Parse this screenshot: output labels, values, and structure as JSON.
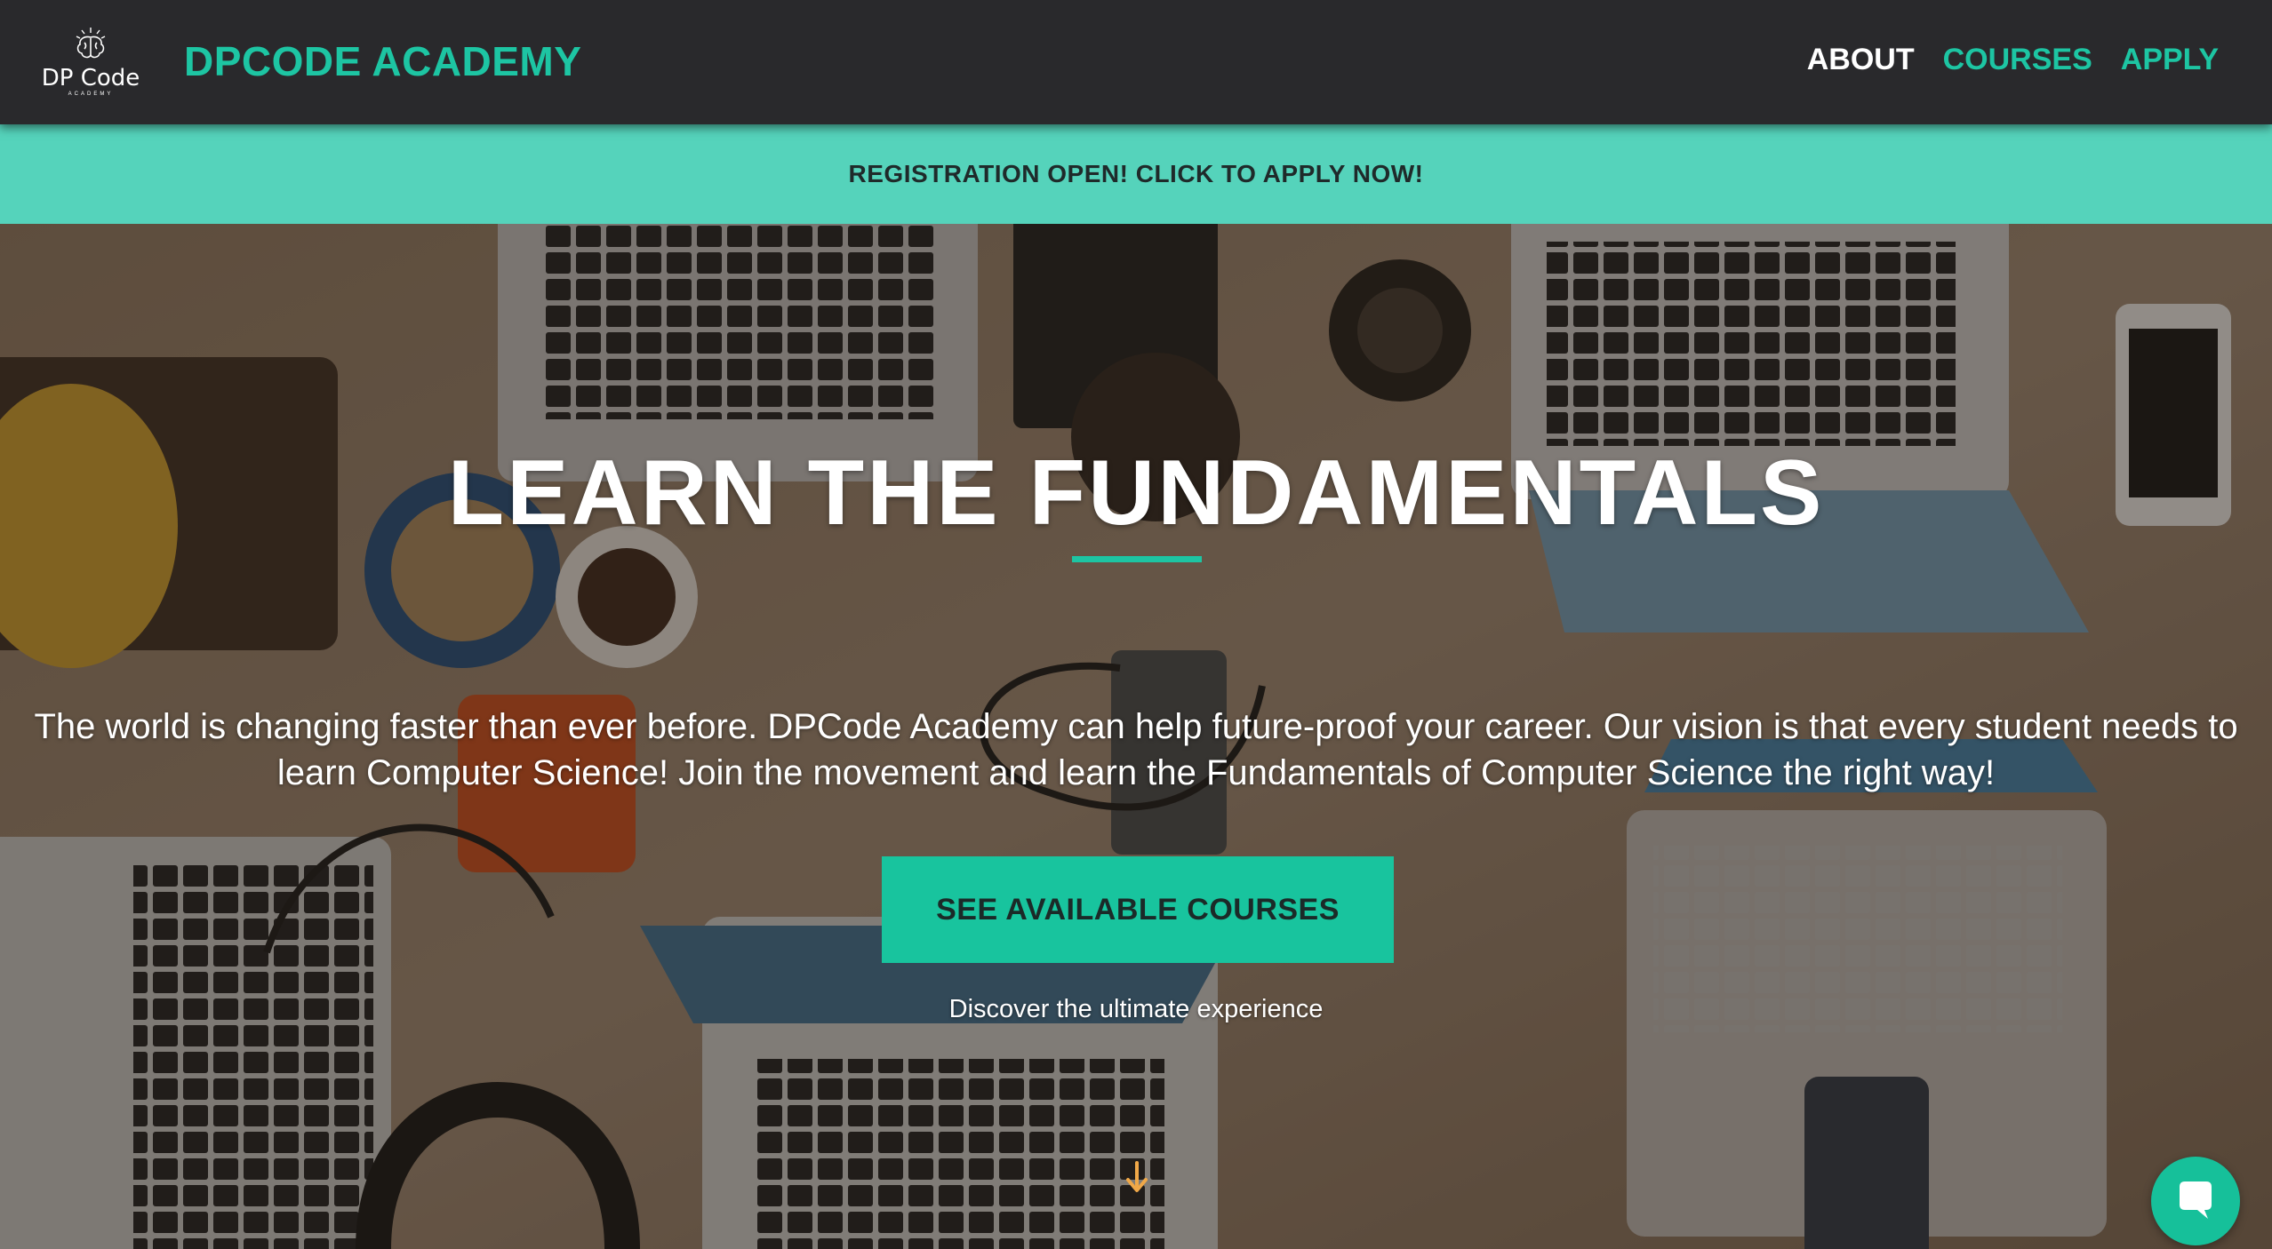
{
  "header": {
    "logo_text": "DP Code",
    "logo_subtext": "ACADEMY",
    "brand": "DPCODE ACADEMY",
    "nav": [
      {
        "label": "ABOUT"
      },
      {
        "label": "COURSES"
      },
      {
        "label": "APPLY"
      }
    ]
  },
  "banner": {
    "text": "REGISTRATION OPEN! CLICK TO APPLY NOW!"
  },
  "hero": {
    "title": "LEARN THE FUNDAMENTALS",
    "description": "The world is changing faster than ever before. DPCode Academy can help future-proof your career. Our vision is that every student needs to learn Computer Science! Join the movement and learn the Fundamentals of Computer Science the right way!",
    "cta_label": "SEE AVAILABLE COURSES",
    "cta_subtext": "Discover the ultimate experience",
    "scroll_icon": "arrow-down-icon"
  },
  "chat": {
    "icon": "chat-bubble-icon"
  },
  "colors": {
    "accent": "#1dc5a3",
    "banner": "#55d3bb",
    "navbar": "#29292c",
    "cta": "#18c49e",
    "scroll_arrow": "#f0a848"
  }
}
